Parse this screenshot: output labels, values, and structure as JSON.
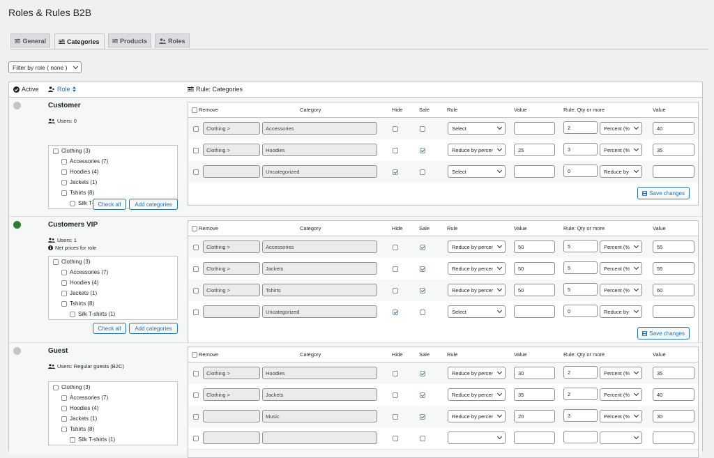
{
  "page": {
    "title": "Roles & Rules B2B"
  },
  "tabs": [
    {
      "label": "General",
      "icon": "sliders-icon"
    },
    {
      "label": "Categories",
      "icon": "sliders-icon",
      "active": true
    },
    {
      "label": "Products",
      "icon": "sliders-icon"
    },
    {
      "label": "Roles",
      "icon": "users-icon"
    }
  ],
  "filter": {
    "label": "Filter by role ( none )"
  },
  "table": {
    "col_active": "Active",
    "col_role": "Role",
    "col_rule": "Rule: Categories"
  },
  "rule_headers": {
    "remove": "Remove",
    "category": "Category",
    "hide": "Hide",
    "sale": "Sale",
    "rule": "Rule",
    "value": "Value",
    "qty": "Rule: Qty or more",
    "value2": "Value"
  },
  "buttons": {
    "check_all": "Check all",
    "add_categories": "Add categories",
    "save": "Save changes"
  },
  "colors": {
    "accent": "#2271b1",
    "active": "#2e7d32",
    "inactive": "#c3c4c7"
  },
  "roles": [
    {
      "name": "Customer",
      "active": false,
      "users": "Users: 0",
      "note": "",
      "categories": [
        {
          "label": "Clothing (3)",
          "level": 0
        },
        {
          "label": "Accessories (7)",
          "level": 1
        },
        {
          "label": "Hoodies (4)",
          "level": 1
        },
        {
          "label": "Jackets (1)",
          "level": 1
        },
        {
          "label": "Tshirts (8)",
          "level": 1
        },
        {
          "label": "Silk T-shirts (1)",
          "level": 2
        }
      ],
      "rules": [
        {
          "parent": "Clothing >",
          "category": "Accessories",
          "hide": false,
          "sale": false,
          "rule": "Select",
          "value": "",
          "qty": "2",
          "qty_rule": "Percent (%",
          "value2": "40"
        },
        {
          "parent": "Clothing >",
          "category": "Hoodies",
          "hide": false,
          "sale": true,
          "rule": "Reduce by percer",
          "value": "25",
          "qty": "3",
          "qty_rule": "Percent (%",
          "value2": "35"
        },
        {
          "parent": "",
          "category": "Uncategorized",
          "hide": true,
          "sale": false,
          "rule": "Select",
          "value": "",
          "qty": "0",
          "qty_rule": "Reduce by",
          "value2": ""
        }
      ]
    },
    {
      "name": "Customers VIP",
      "active": true,
      "users": "Users: 1",
      "note": "Net prices for role",
      "categories": [
        {
          "label": "Clothing (3)",
          "level": 0
        },
        {
          "label": "Accessories (7)",
          "level": 1
        },
        {
          "label": "Hoodies (4)",
          "level": 1
        },
        {
          "label": "Jackets (1)",
          "level": 1
        },
        {
          "label": "Tshirts (8)",
          "level": 1
        },
        {
          "label": "Silk T-shirts (1)",
          "level": 2
        }
      ],
      "rules": [
        {
          "parent": "Clothing >",
          "category": "Accessories",
          "hide": false,
          "sale": true,
          "rule": "Reduce by percer",
          "value": "50",
          "qty": "5",
          "qty_rule": "Percent (%",
          "value2": "55"
        },
        {
          "parent": "Clothing >",
          "category": "Jackets",
          "hide": false,
          "sale": true,
          "rule": "Reduce by percer",
          "value": "50",
          "qty": "5",
          "qty_rule": "Percent (%",
          "value2": "55"
        },
        {
          "parent": "Clothing >",
          "category": "Tshirts",
          "hide": false,
          "sale": true,
          "rule": "Reduce by percer",
          "value": "50",
          "qty": "5",
          "qty_rule": "Percent (%",
          "value2": "60"
        },
        {
          "parent": "",
          "category": "Uncategorized",
          "hide": true,
          "sale": false,
          "rule": "Select",
          "value": "",
          "qty": "0",
          "qty_rule": "Reduce by",
          "value2": ""
        }
      ]
    },
    {
      "name": "Guest",
      "active": false,
      "users": "Users: Regular guests (B2C)",
      "note": "",
      "categories": [
        {
          "label": "Clothing (3)",
          "level": 0
        },
        {
          "label": "Accessories (7)",
          "level": 1
        },
        {
          "label": "Hoodies (4)",
          "level": 1
        },
        {
          "label": "Jackets (1)",
          "level": 1
        },
        {
          "label": "Tshirts (8)",
          "level": 1
        },
        {
          "label": "Silk T-shirts (1)",
          "level": 2
        }
      ],
      "rules": [
        {
          "parent": "Clothing >",
          "category": "Hoodies",
          "hide": false,
          "sale": true,
          "rule": "Reduce by percer",
          "value": "30",
          "qty": "2",
          "qty_rule": "Percent (%",
          "value2": "35"
        },
        {
          "parent": "Clothing >",
          "category": "Jackets",
          "hide": false,
          "sale": true,
          "rule": "Reduce by percer",
          "value": "35",
          "qty": "2",
          "qty_rule": "Percent (%",
          "value2": "40"
        },
        {
          "parent": "",
          "category": "Music",
          "hide": false,
          "sale": true,
          "rule": "Reduce by percer",
          "value": "20",
          "qty": "3",
          "qty_rule": "Percent (%",
          "value2": "30"
        },
        {
          "parent": "",
          "category": "",
          "hide": false,
          "sale": false,
          "rule": "",
          "value": "",
          "qty": "",
          "qty_rule": "",
          "value2": ""
        }
      ]
    }
  ]
}
